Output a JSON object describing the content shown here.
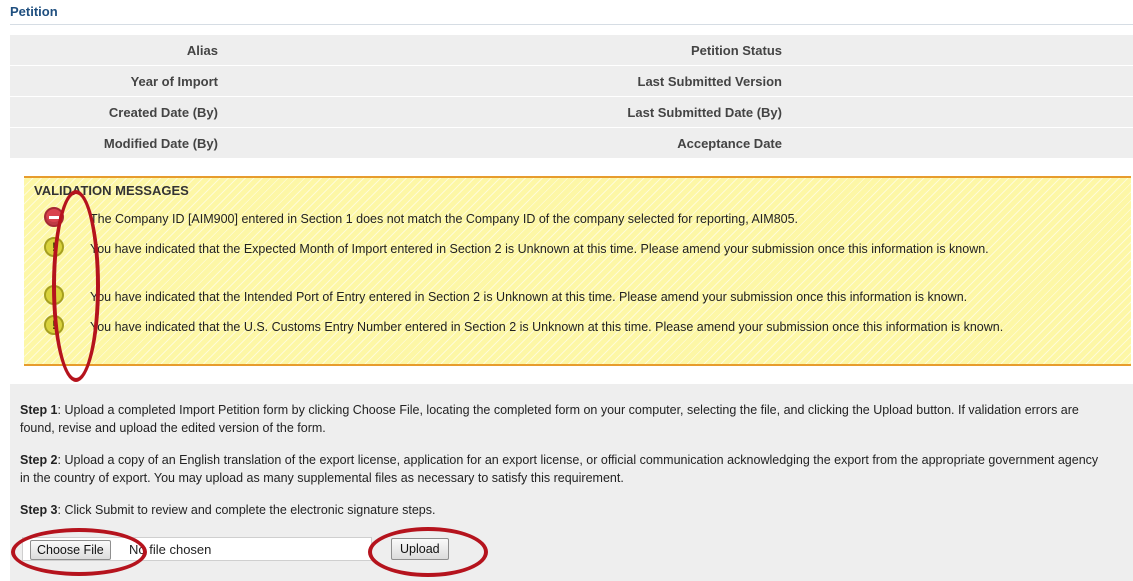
{
  "section": {
    "title": "Petition"
  },
  "info_rows": [
    {
      "left": "Alias",
      "right": "Petition Status"
    },
    {
      "left": "Year of Import",
      "right": "Last Submitted Version"
    },
    {
      "left": "Created Date (By)",
      "right": "Last Submitted Date (By)"
    },
    {
      "left": "Modified Date (By)",
      "right": "Acceptance Date"
    }
  ],
  "validation": {
    "title": "VALIDATION MESSAGES",
    "messages": [
      {
        "type": "error",
        "icon": "stop-error-icon",
        "text": "The Company ID [AIM900] entered in Section 1 does not match the Company ID of the company selected for reporting, AIM805."
      },
      {
        "type": "warning",
        "icon": "warning-icon",
        "text": "You have indicated that the Expected Month of Import entered in Section 2 is Unknown at this time. Please amend your submission once this information is known."
      },
      {
        "type": "warning",
        "icon": "warning-icon",
        "text": "You have indicated that the Intended Port of Entry entered in Section 2 is Unknown at this time. Please amend your submission once this information is known."
      },
      {
        "type": "warning",
        "icon": "warning-icon",
        "text": "You have indicated that the U.S. Customs Entry Number entered in Section 2 is Unknown at this time. Please amend your submission once this information is known."
      }
    ]
  },
  "steps": [
    {
      "label": "Step 1",
      "text": ": Upload a completed Import Petition form by clicking Choose File, locating the completed form on your computer, selecting the file, and clicking the Upload button. If validation errors are found, revise and upload the edited version of the form."
    },
    {
      "label": "Step 2",
      "text": ": Upload a copy of an English translation of the export license, application for an export license, or official communication acknowledging the export from the appropriate government agency in the country of export. You may upload as many supplemental files as necessary to satisfy this requirement."
    },
    {
      "label": "Step 3",
      "text": ": Click Submit to review and complete the electronic signature steps."
    }
  ],
  "upload": {
    "choose_label": "Choose File",
    "file_status": "No file chosen",
    "upload_label": "Upload"
  },
  "colors": {
    "title_blue": "#1f4f7f",
    "validation_bg": "#fdf7a6",
    "validation_border": "#e79c2d",
    "annotation_red": "#b5131d"
  }
}
